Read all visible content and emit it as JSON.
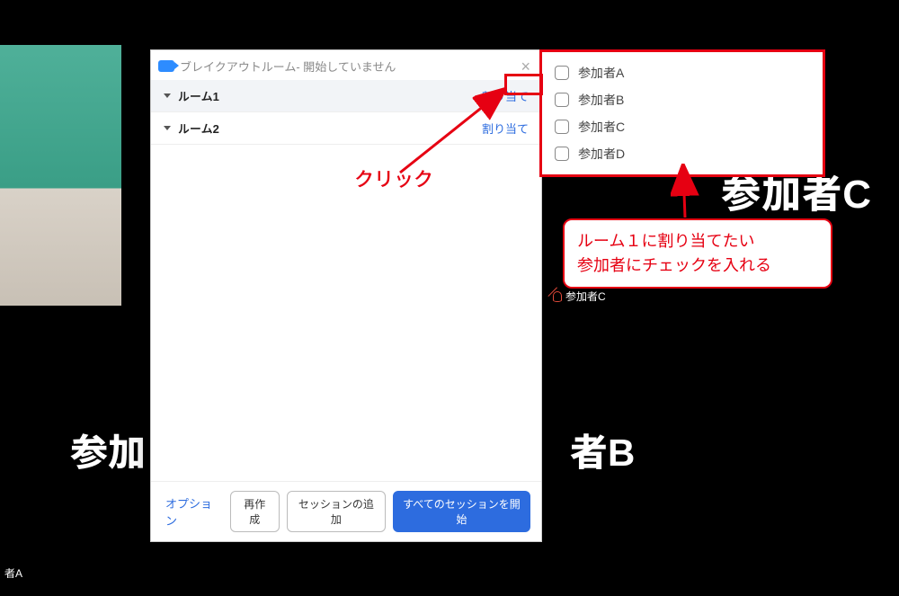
{
  "dialog": {
    "title": "ブレイクアウトルーム- 開始していません",
    "rooms": [
      {
        "name": "ルーム1",
        "assign": "割り当て"
      },
      {
        "name": "ルーム2",
        "assign": "割り当て"
      }
    ],
    "footer": {
      "options": "オプション",
      "recreate": "再作成",
      "add_session": "セッションの追加",
      "start_all": "すべてのセッションを開始"
    }
  },
  "assign_panel": {
    "participants": [
      "参加者A",
      "参加者B",
      "参加者C",
      "参加者D"
    ]
  },
  "annotations": {
    "click_label": "クリック",
    "callout_line1": "ルーム１に割り当てたい",
    "callout_line2": "参加者にチェックを入れる"
  },
  "background": {
    "big_name_top_right": "参加者C",
    "big_name_bottom_left_fragment": "参加",
    "big_name_bottom_right_fragment": "者B",
    "small_tag_right": "参加者C",
    "small_tag_left": "者A"
  }
}
